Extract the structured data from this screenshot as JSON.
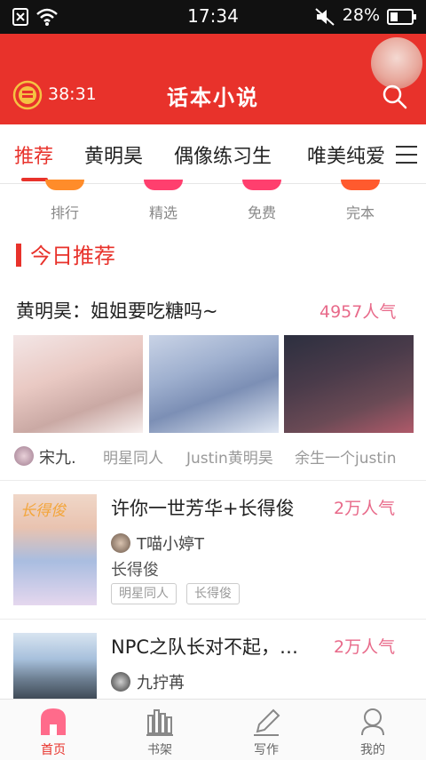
{
  "status_bar": {
    "time": "17:34",
    "battery": "28%"
  },
  "header": {
    "title": "话本小说",
    "timer": "38:31"
  },
  "tabs": [
    {
      "label": "推荐"
    },
    {
      "label": "黄明昊"
    },
    {
      "label": "偶像练习生"
    },
    {
      "label": "唯美纯爱"
    }
  ],
  "categories": [
    {
      "label": "排行"
    },
    {
      "label": "精选"
    },
    {
      "label": "免费"
    },
    {
      "label": "完本"
    }
  ],
  "section": {
    "title": "今日推荐"
  },
  "featured": {
    "title": "黄明昊：姐姐要吃糖吗~",
    "popularity": "4957人气",
    "author": "宋九.",
    "tags": [
      "明星同人",
      "Justin黄明昊",
      "余生一个justin"
    ]
  },
  "books": [
    {
      "title": "许你一世芳华+长得俊",
      "popularity": "2万人气",
      "author": "T喵小婷T",
      "subtitle": "长得俊",
      "tags": [
        "明星同人",
        "长得俊"
      ],
      "cover_text": "长得俊"
    },
    {
      "title": "NPC之队长对不起，…",
      "popularity": "2万人气",
      "author": "九拧苒"
    }
  ],
  "bottom_nav": [
    {
      "label": "首页"
    },
    {
      "label": "书架"
    },
    {
      "label": "写作"
    },
    {
      "label": "我的"
    }
  ],
  "colors": {
    "brand_red": "#e8322b",
    "popularity_pink": "#e86a8a"
  }
}
